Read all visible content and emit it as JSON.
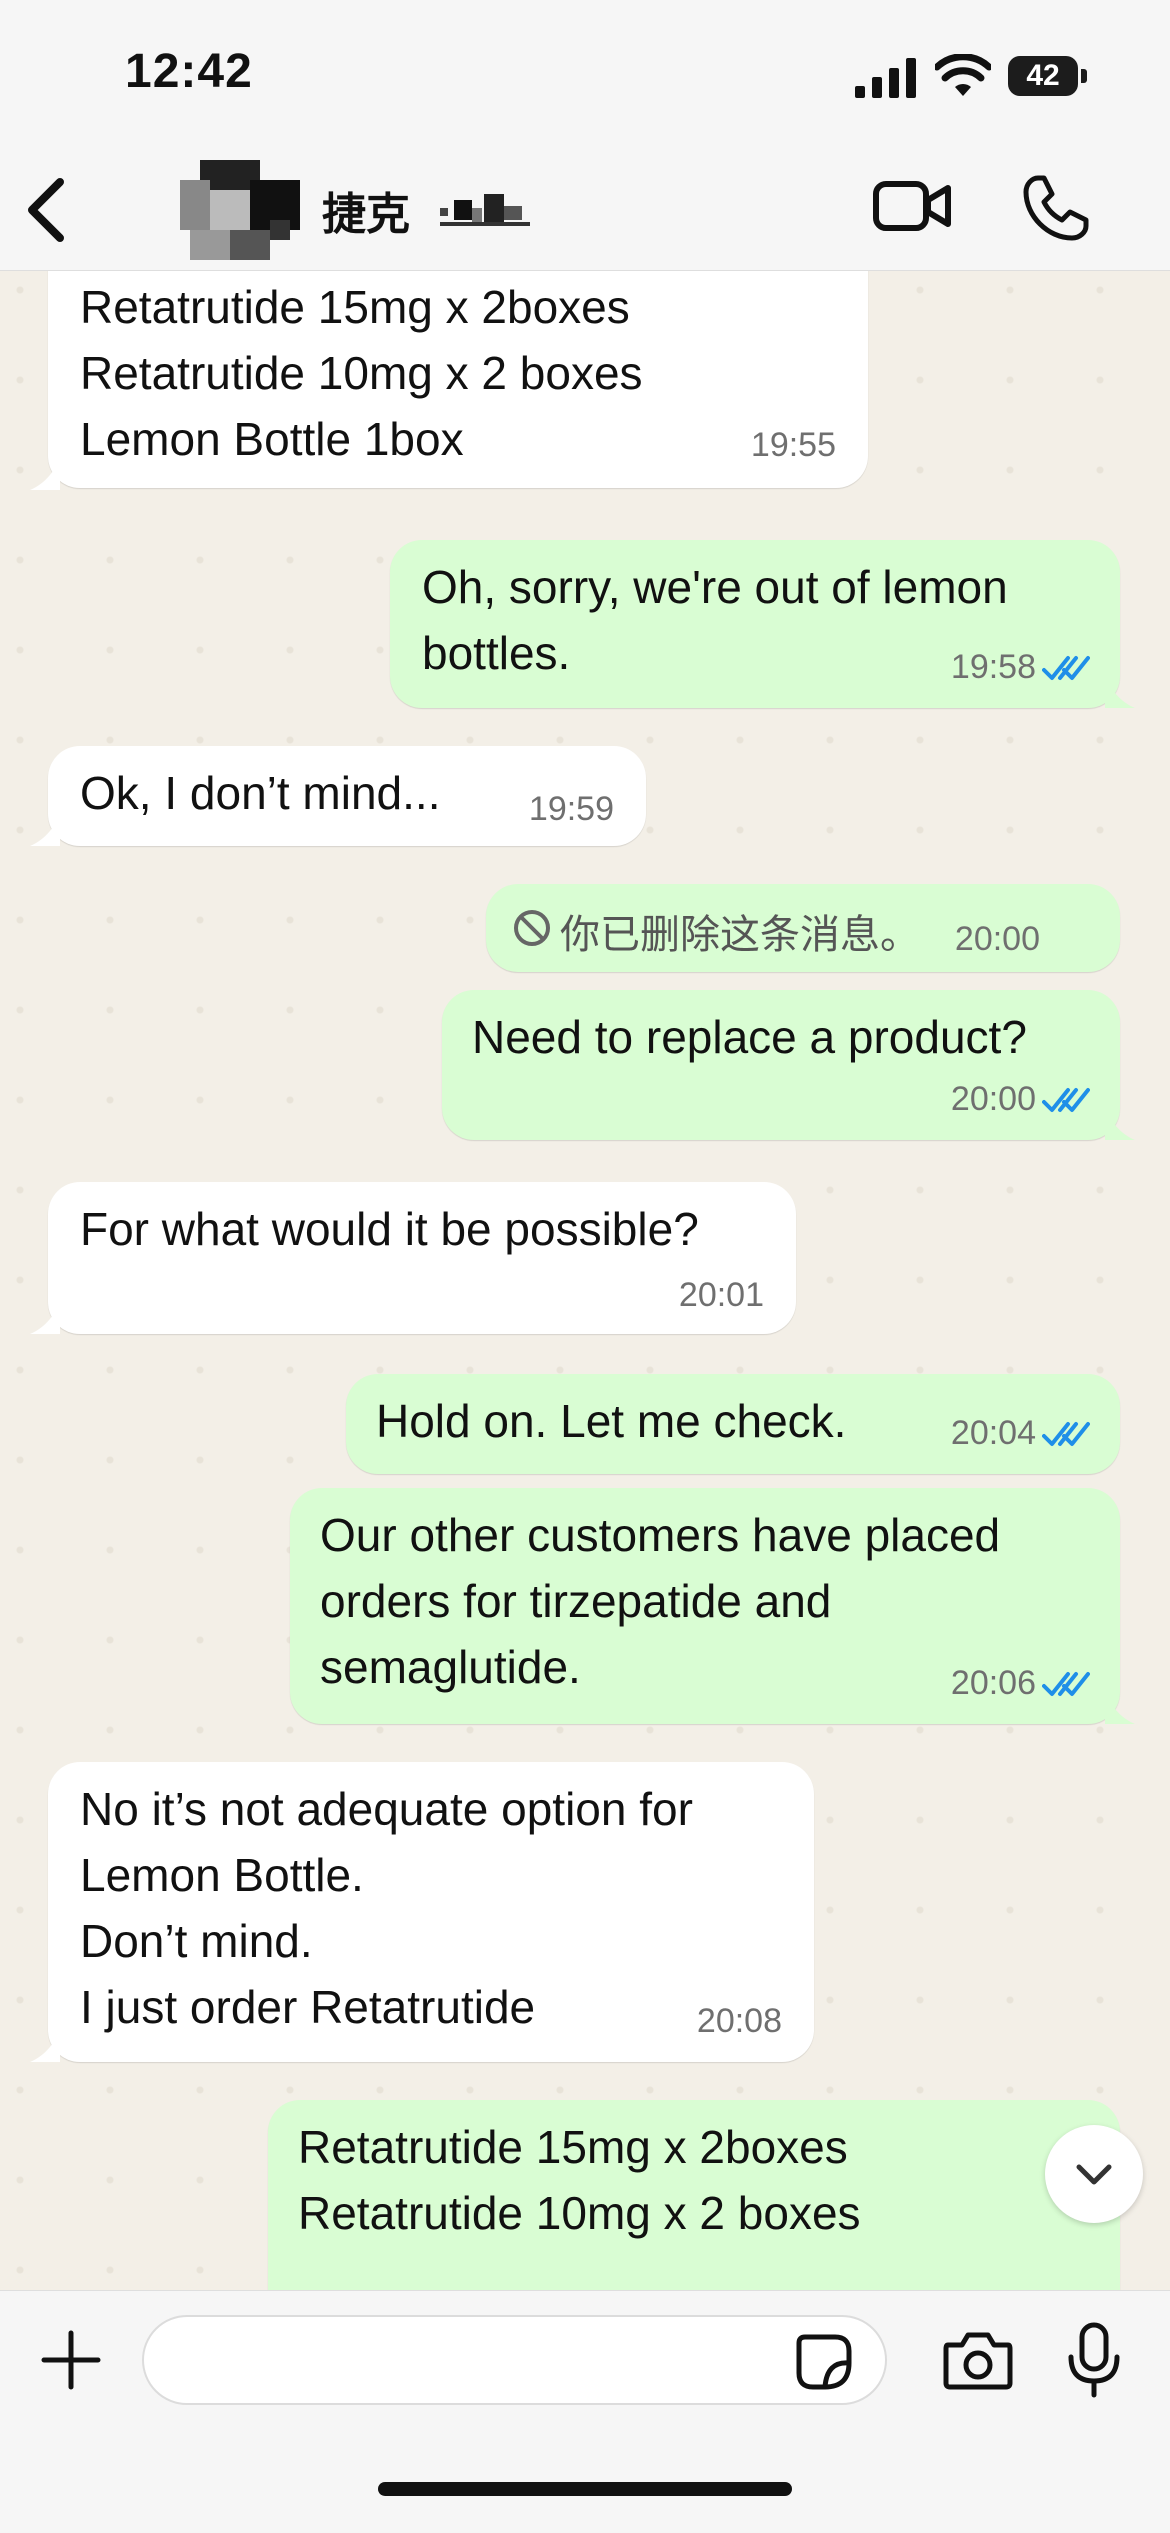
{
  "status_bar": {
    "time": "12:42",
    "battery": "42"
  },
  "header": {
    "contact_name": "捷克"
  },
  "messages": [
    {
      "direction": "in",
      "lines": [
        "Retatrutide 15mg x 2boxes",
        "Retatrutide 10mg x 2 boxes",
        "Lemon Bottle 1box"
      ],
      "time": "19:55"
    },
    {
      "direction": "out",
      "lines": [
        "Oh, sorry, we're out of lemon",
        "bottles."
      ],
      "time": "19:58",
      "read": true
    },
    {
      "direction": "in",
      "lines": [
        "Ok, I don’t mind..."
      ],
      "time": "19:59"
    },
    {
      "direction": "out",
      "deleted": true,
      "text": "你已删除这条消息。",
      "time": "20:00"
    },
    {
      "direction": "out",
      "lines": [
        "Need to replace a product?"
      ],
      "time": "20:00",
      "read": true
    },
    {
      "direction": "in",
      "lines": [
        "For what would it be possible?"
      ],
      "time": "20:01"
    },
    {
      "direction": "out",
      "lines": [
        "Hold on. Let me check."
      ],
      "time": "20:04",
      "read": true
    },
    {
      "direction": "out",
      "lines": [
        "Our other customers have placed",
        "orders for tirzepatide and",
        "semaglutide."
      ],
      "time": "20:06",
      "read": true
    },
    {
      "direction": "in",
      "lines": [
        "No it’s not adequate option for",
        "Lemon Bottle.",
        "Don’t mind.",
        "I just order Retatrutide"
      ],
      "time": "20:08"
    },
    {
      "direction": "out",
      "lines": [
        "Retatrutide 15mg x 2boxes",
        "Retatrutide 10mg x 2 boxes"
      ]
    }
  ],
  "colors": {
    "incoming_bubble": "#ffffff",
    "outgoing_bubble": "#d9fdd3",
    "read_ticks": "#1f8fe8",
    "chat_background": "#f3efe7"
  },
  "icons": {
    "back": "chevron-left-icon",
    "video": "video-camera-icon",
    "call": "phone-icon",
    "scroll": "chevron-down-icon",
    "attach": "plus-icon",
    "sticker": "sticker-icon",
    "camera": "camera-icon",
    "mic": "microphone-icon"
  }
}
